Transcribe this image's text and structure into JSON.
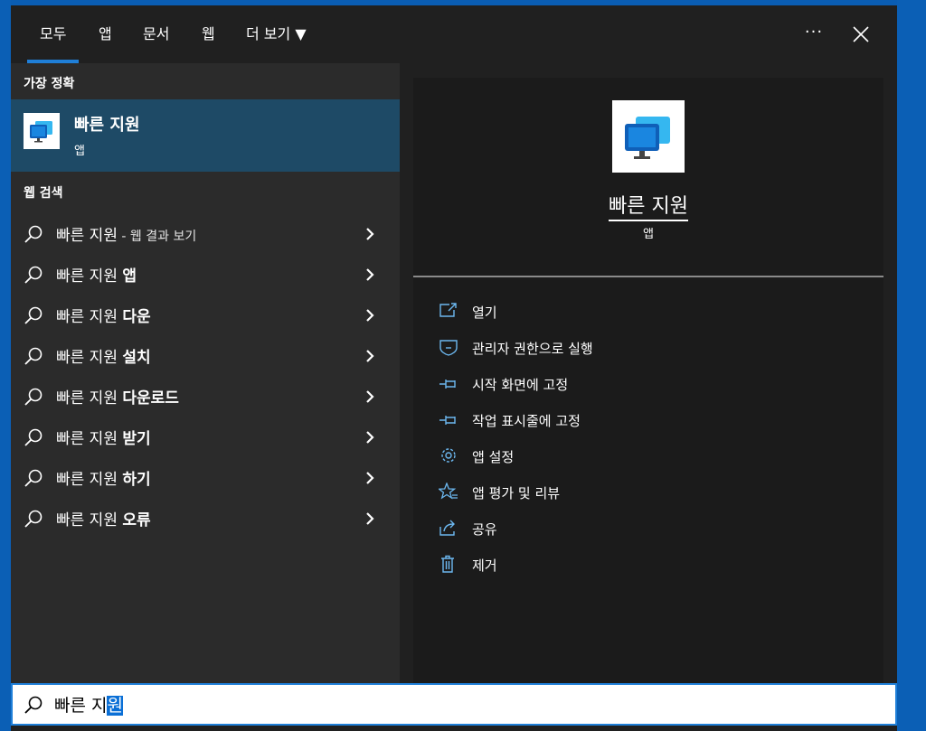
{
  "tabs": [
    {
      "label": "모두",
      "active": true
    },
    {
      "label": "앱"
    },
    {
      "label": "문서"
    },
    {
      "label": "웹"
    },
    {
      "label": "더 보기 ▼"
    }
  ],
  "more_label": "···",
  "best_match": {
    "section_title": "가장 정확",
    "name": "빠른 지원",
    "type": "앱"
  },
  "web_search": {
    "section_title": "웹 검색",
    "items": [
      {
        "prefix": "빠른 지원",
        "suffix": "",
        "small": " - 웹 결과 보기"
      },
      {
        "prefix": "빠른 지원 ",
        "suffix": "앱",
        "small": ""
      },
      {
        "prefix": "빠른 지원 ",
        "suffix": "다운",
        "small": ""
      },
      {
        "prefix": "빠른 지원 ",
        "suffix": "설치",
        "small": ""
      },
      {
        "prefix": "빠른 지원 ",
        "suffix": "다운로드",
        "small": ""
      },
      {
        "prefix": "빠른 지원 ",
        "suffix": "받기",
        "small": ""
      },
      {
        "prefix": "빠른 지원 ",
        "suffix": "하기",
        "small": ""
      },
      {
        "prefix": "빠른 지원 ",
        "suffix": "오류",
        "small": ""
      }
    ]
  },
  "detail": {
    "name": "빠른 지원",
    "type": "앱",
    "actions": [
      {
        "label": "열기",
        "icon": "open-icon"
      },
      {
        "label": "관리자 권한으로 실행",
        "icon": "shield-icon"
      },
      {
        "label": "시작 화면에 고정",
        "icon": "pin-icon"
      },
      {
        "label": "작업 표시줄에 고정",
        "icon": "pin-icon"
      },
      {
        "label": "앱 설정",
        "icon": "gear-icon"
      },
      {
        "label": "앱 평가 및 리뷰",
        "icon": "star-icon"
      },
      {
        "label": "공유",
        "icon": "share-icon"
      },
      {
        "label": "제거",
        "icon": "trash-icon"
      }
    ]
  },
  "search": {
    "text_plain": "빠른 지",
    "text_selected": "원"
  },
  "colors": {
    "accent": "#1f7fd8",
    "selected_row": "#1e4a66",
    "panel": "#202020",
    "left_pane": "#2b2b2b",
    "desktop": "#0b5fb5"
  }
}
